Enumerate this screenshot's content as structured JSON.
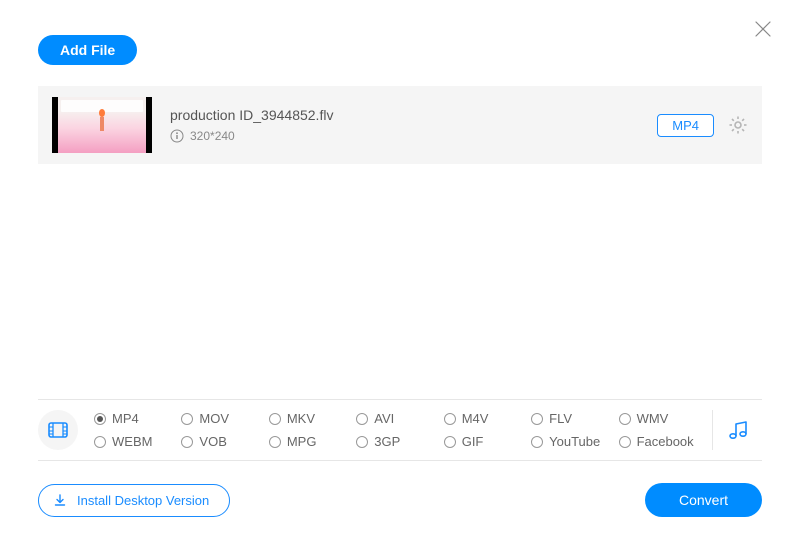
{
  "header": {
    "add_file_label": "Add File"
  },
  "file": {
    "name": "production ID_3944852.flv",
    "resolution": "320*240",
    "output_format_badge": "MP4"
  },
  "formats": {
    "selected": "MP4",
    "row1": [
      "MP4",
      "MOV",
      "MKV",
      "AVI",
      "M4V",
      "FLV",
      "WMV"
    ],
    "row2": [
      "WEBM",
      "VOB",
      "MPG",
      "3GP",
      "GIF",
      "YouTube",
      "Facebook"
    ]
  },
  "footer": {
    "install_label": "Install Desktop Version",
    "convert_label": "Convert"
  }
}
